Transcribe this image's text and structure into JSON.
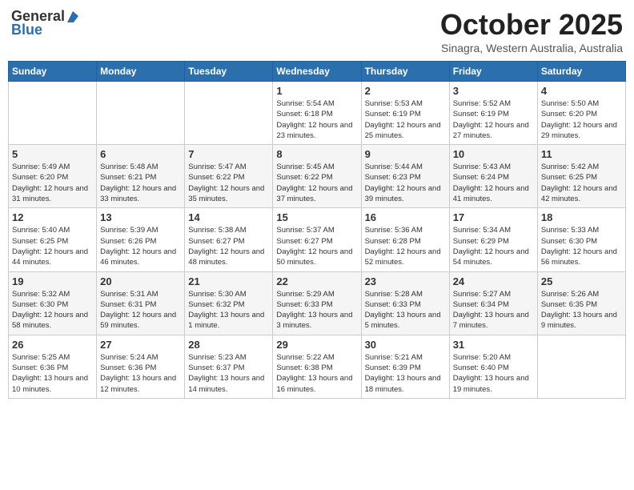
{
  "logo": {
    "general": "General",
    "blue": "Blue"
  },
  "header": {
    "month": "October 2025",
    "location": "Sinagra, Western Australia, Australia"
  },
  "weekdays": [
    "Sunday",
    "Monday",
    "Tuesday",
    "Wednesday",
    "Thursday",
    "Friday",
    "Saturday"
  ],
  "weeks": [
    [
      {
        "day": "",
        "info": ""
      },
      {
        "day": "",
        "info": ""
      },
      {
        "day": "",
        "info": ""
      },
      {
        "day": "1",
        "info": "Sunrise: 5:54 AM\nSunset: 6:18 PM\nDaylight: 12 hours\nand 23 minutes."
      },
      {
        "day": "2",
        "info": "Sunrise: 5:53 AM\nSunset: 6:19 PM\nDaylight: 12 hours\nand 25 minutes."
      },
      {
        "day": "3",
        "info": "Sunrise: 5:52 AM\nSunset: 6:19 PM\nDaylight: 12 hours\nand 27 minutes."
      },
      {
        "day": "4",
        "info": "Sunrise: 5:50 AM\nSunset: 6:20 PM\nDaylight: 12 hours\nand 29 minutes."
      }
    ],
    [
      {
        "day": "5",
        "info": "Sunrise: 5:49 AM\nSunset: 6:20 PM\nDaylight: 12 hours\nand 31 minutes."
      },
      {
        "day": "6",
        "info": "Sunrise: 5:48 AM\nSunset: 6:21 PM\nDaylight: 12 hours\nand 33 minutes."
      },
      {
        "day": "7",
        "info": "Sunrise: 5:47 AM\nSunset: 6:22 PM\nDaylight: 12 hours\nand 35 minutes."
      },
      {
        "day": "8",
        "info": "Sunrise: 5:45 AM\nSunset: 6:22 PM\nDaylight: 12 hours\nand 37 minutes."
      },
      {
        "day": "9",
        "info": "Sunrise: 5:44 AM\nSunset: 6:23 PM\nDaylight: 12 hours\nand 39 minutes."
      },
      {
        "day": "10",
        "info": "Sunrise: 5:43 AM\nSunset: 6:24 PM\nDaylight: 12 hours\nand 41 minutes."
      },
      {
        "day": "11",
        "info": "Sunrise: 5:42 AM\nSunset: 6:25 PM\nDaylight: 12 hours\nand 42 minutes."
      }
    ],
    [
      {
        "day": "12",
        "info": "Sunrise: 5:40 AM\nSunset: 6:25 PM\nDaylight: 12 hours\nand 44 minutes."
      },
      {
        "day": "13",
        "info": "Sunrise: 5:39 AM\nSunset: 6:26 PM\nDaylight: 12 hours\nand 46 minutes."
      },
      {
        "day": "14",
        "info": "Sunrise: 5:38 AM\nSunset: 6:27 PM\nDaylight: 12 hours\nand 48 minutes."
      },
      {
        "day": "15",
        "info": "Sunrise: 5:37 AM\nSunset: 6:27 PM\nDaylight: 12 hours\nand 50 minutes."
      },
      {
        "day": "16",
        "info": "Sunrise: 5:36 AM\nSunset: 6:28 PM\nDaylight: 12 hours\nand 52 minutes."
      },
      {
        "day": "17",
        "info": "Sunrise: 5:34 AM\nSunset: 6:29 PM\nDaylight: 12 hours\nand 54 minutes."
      },
      {
        "day": "18",
        "info": "Sunrise: 5:33 AM\nSunset: 6:30 PM\nDaylight: 12 hours\nand 56 minutes."
      }
    ],
    [
      {
        "day": "19",
        "info": "Sunrise: 5:32 AM\nSunset: 6:30 PM\nDaylight: 12 hours\nand 58 minutes."
      },
      {
        "day": "20",
        "info": "Sunrise: 5:31 AM\nSunset: 6:31 PM\nDaylight: 12 hours\nand 59 minutes."
      },
      {
        "day": "21",
        "info": "Sunrise: 5:30 AM\nSunset: 6:32 PM\nDaylight: 13 hours\nand 1 minute."
      },
      {
        "day": "22",
        "info": "Sunrise: 5:29 AM\nSunset: 6:33 PM\nDaylight: 13 hours\nand 3 minutes."
      },
      {
        "day": "23",
        "info": "Sunrise: 5:28 AM\nSunset: 6:33 PM\nDaylight: 13 hours\nand 5 minutes."
      },
      {
        "day": "24",
        "info": "Sunrise: 5:27 AM\nSunset: 6:34 PM\nDaylight: 13 hours\nand 7 minutes."
      },
      {
        "day": "25",
        "info": "Sunrise: 5:26 AM\nSunset: 6:35 PM\nDaylight: 13 hours\nand 9 minutes."
      }
    ],
    [
      {
        "day": "26",
        "info": "Sunrise: 5:25 AM\nSunset: 6:36 PM\nDaylight: 13 hours\nand 10 minutes."
      },
      {
        "day": "27",
        "info": "Sunrise: 5:24 AM\nSunset: 6:36 PM\nDaylight: 13 hours\nand 12 minutes."
      },
      {
        "day": "28",
        "info": "Sunrise: 5:23 AM\nSunset: 6:37 PM\nDaylight: 13 hours\nand 14 minutes."
      },
      {
        "day": "29",
        "info": "Sunrise: 5:22 AM\nSunset: 6:38 PM\nDaylight: 13 hours\nand 16 minutes."
      },
      {
        "day": "30",
        "info": "Sunrise: 5:21 AM\nSunset: 6:39 PM\nDaylight: 13 hours\nand 18 minutes."
      },
      {
        "day": "31",
        "info": "Sunrise: 5:20 AM\nSunset: 6:40 PM\nDaylight: 13 hours\nand 19 minutes."
      },
      {
        "day": "",
        "info": ""
      }
    ]
  ]
}
